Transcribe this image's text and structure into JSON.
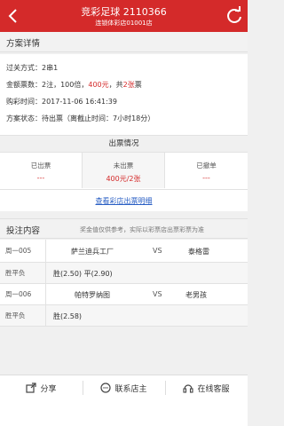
{
  "header": {
    "title": "竞彩足球  2110366",
    "subtitle": "连锁体彩店01001店"
  },
  "details": {
    "section_title": "方案详情",
    "pass_label": "过关方式：",
    "pass_value": "2串1",
    "amount_label": "金额票数：",
    "amount_prefix": "2注，100倍，",
    "amount_money": "400元",
    "amount_mid": "，共",
    "amount_tickets": "2张",
    "amount_suffix": "票",
    "buy_time_label": "购彩时间：",
    "buy_time_value": "2017-11-06 16:41:39",
    "status_label": "方案状态：",
    "status_value": "待出票（离截止时间：7小时18分）"
  },
  "ticket": {
    "title": "出票情况",
    "issued_label": "已出票",
    "issued_value": "---",
    "pending_label": "未出票",
    "pending_value": "400元/2张",
    "cancelled_label": "已撤单",
    "cancelled_value": "---",
    "detail_link": "查看彩店出票明细"
  },
  "bet": {
    "title": "投注内容",
    "note": "奖金值仅供参考，实际以彩票店出票彩票为准",
    "matches": [
      {
        "code": "周一005",
        "home": "萨兰迪兵工厂",
        "vs": "VS",
        "away": "泰格雷",
        "play": "胜平负",
        "odds": "胜(2.50) 平(2.90)"
      },
      {
        "code": "周一006",
        "home": "帕特罗纳图",
        "vs": "VS",
        "away": "老男孩",
        "play": "胜平负",
        "odds": "胜(2.58)"
      }
    ]
  },
  "footer": {
    "share": "分享",
    "contact": "联系店主",
    "service": "在线客服"
  },
  "colors": {
    "brand": "#d42a2a",
    "link": "#2a5fc4"
  }
}
